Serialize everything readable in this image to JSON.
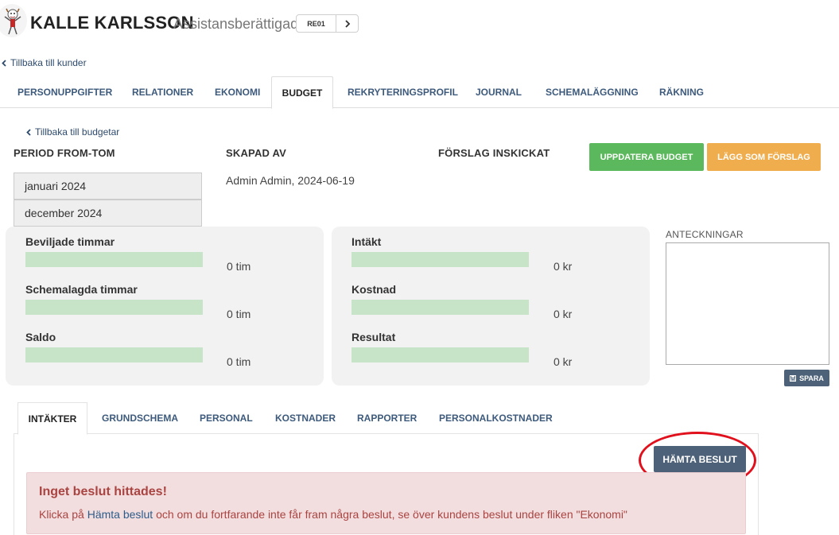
{
  "header": {
    "customer_name": "KALLE KARLSSON",
    "customer_role": "Assistansberättigad",
    "customer_code": "RE01"
  },
  "nav": {
    "back_to_customers": "Tillbaka till kunder",
    "back_to_budgets": "Tillbaka till budgetar"
  },
  "main_tabs": [
    {
      "label": "PERSONUPPGIFTER"
    },
    {
      "label": "RELATIONER"
    },
    {
      "label": "EKONOMI"
    },
    {
      "label": "BUDGET"
    },
    {
      "label": "REKRYTERINGSPROFIL"
    },
    {
      "label": "JOURNAL"
    },
    {
      "label": "SCHEMALÄGGNING"
    },
    {
      "label": "RÄKNING"
    }
  ],
  "budget": {
    "period_label": "PERIOD FROM-TOM",
    "period_from": "januari 2024",
    "period_to": "december 2024",
    "created_by_label": "SKAPAD AV",
    "created_by_value": "Admin Admin, 2024-06-19",
    "proposal_sent_label": "FÖRSLAG INSKICKAT",
    "update_button": "UPPDATERA BUDGET",
    "proposal_button": "LÄGG SOM FÖRSLAG"
  },
  "hours": [
    {
      "label": "Beviljade timmar",
      "value": "0 tim"
    },
    {
      "label": "Schemalagda timmar",
      "value": "0 tim"
    },
    {
      "label": "Saldo",
      "value": "0 tim"
    }
  ],
  "money": [
    {
      "label": "Intäkt",
      "value": "0 kr"
    },
    {
      "label": "Kostnad",
      "value": "0 kr"
    },
    {
      "label": "Resultat",
      "value": "0 kr"
    }
  ],
  "notes": {
    "label": "ANTECKNINGAR",
    "value": "",
    "save_button": "SPARA"
  },
  "sub_tabs": [
    {
      "label": "INTÄKTER"
    },
    {
      "label": "GRUNDSCHEMA"
    },
    {
      "label": "PERSONAL"
    },
    {
      "label": "KOSTNADER"
    },
    {
      "label": "RAPPORTER"
    },
    {
      "label": "PERSONALKOSTNADER"
    }
  ],
  "income": {
    "fetch_button": "HÄMTA BESLUT",
    "alert_title": "Inget beslut hittades!",
    "alert_prefix": "Klicka på ",
    "alert_link": "Hämta beslut",
    "alert_suffix": " och om du fortfarande inte får fram några beslut, se över kundens beslut under fliken \"Ekonomi\""
  },
  "colors": {
    "update_button": "#5cb85c",
    "proposal_button": "#f0ad4e",
    "dark_button": "#4d6278",
    "bar_fill": "#c8e4c8",
    "alert_bg": "#f2dede",
    "highlight_ring": "#e0101c"
  }
}
